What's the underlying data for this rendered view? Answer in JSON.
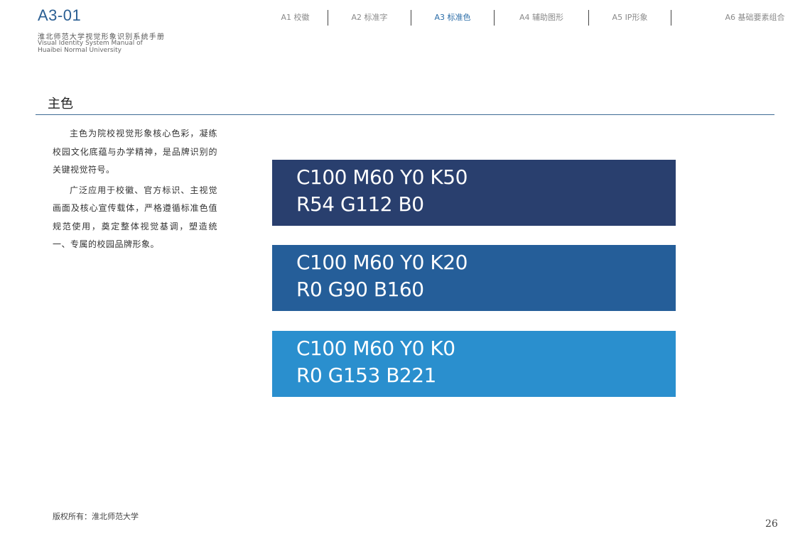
{
  "header": {
    "code": "A3-01",
    "title_cn": "淮北师范大学视觉形象识别系统手册",
    "title_en_line1": "Visual Identity System Manual of",
    "title_en_line2": "Huaibei Normal University"
  },
  "nav": {
    "items": [
      {
        "label": "A1 校徽"
      },
      {
        "label": "A2 标准字"
      },
      {
        "label": "A3 标准色"
      },
      {
        "label": "A4 辅助图形"
      },
      {
        "label": "A5 IP形象"
      },
      {
        "label": "A6 基础要素组合"
      }
    ],
    "active_index": 2
  },
  "section": {
    "title": "主色",
    "paragraphs": [
      "主色为院校视觉形象核心色彩，凝练校园文化底蕴与办学精神，是品牌识别的关键视觉符号。",
      "广泛应用于校徽、官方标识、主视觉画面及核心宣传载体，严格遵循标准色值规范使用，奠定整体视觉基调，塑造统一、专属的校园品牌形象。"
    ]
  },
  "colors": [
    {
      "cmyk": "C100 M60 Y0 K50",
      "rgb": "R54 G112 B0",
      "swatch_hex": "#293f6e"
    },
    {
      "cmyk": "C100 M60 Y0 K20",
      "rgb": "R0 G90 B160",
      "swatch_hex": "#255e99"
    },
    {
      "cmyk": "C100 M60 Y0 K0",
      "rgb": "R0 G153 B221",
      "swatch_hex": "#2a8fce"
    }
  ],
  "footer": {
    "copyright": "版权所有：淮北师范大学",
    "page_number": "26"
  }
}
